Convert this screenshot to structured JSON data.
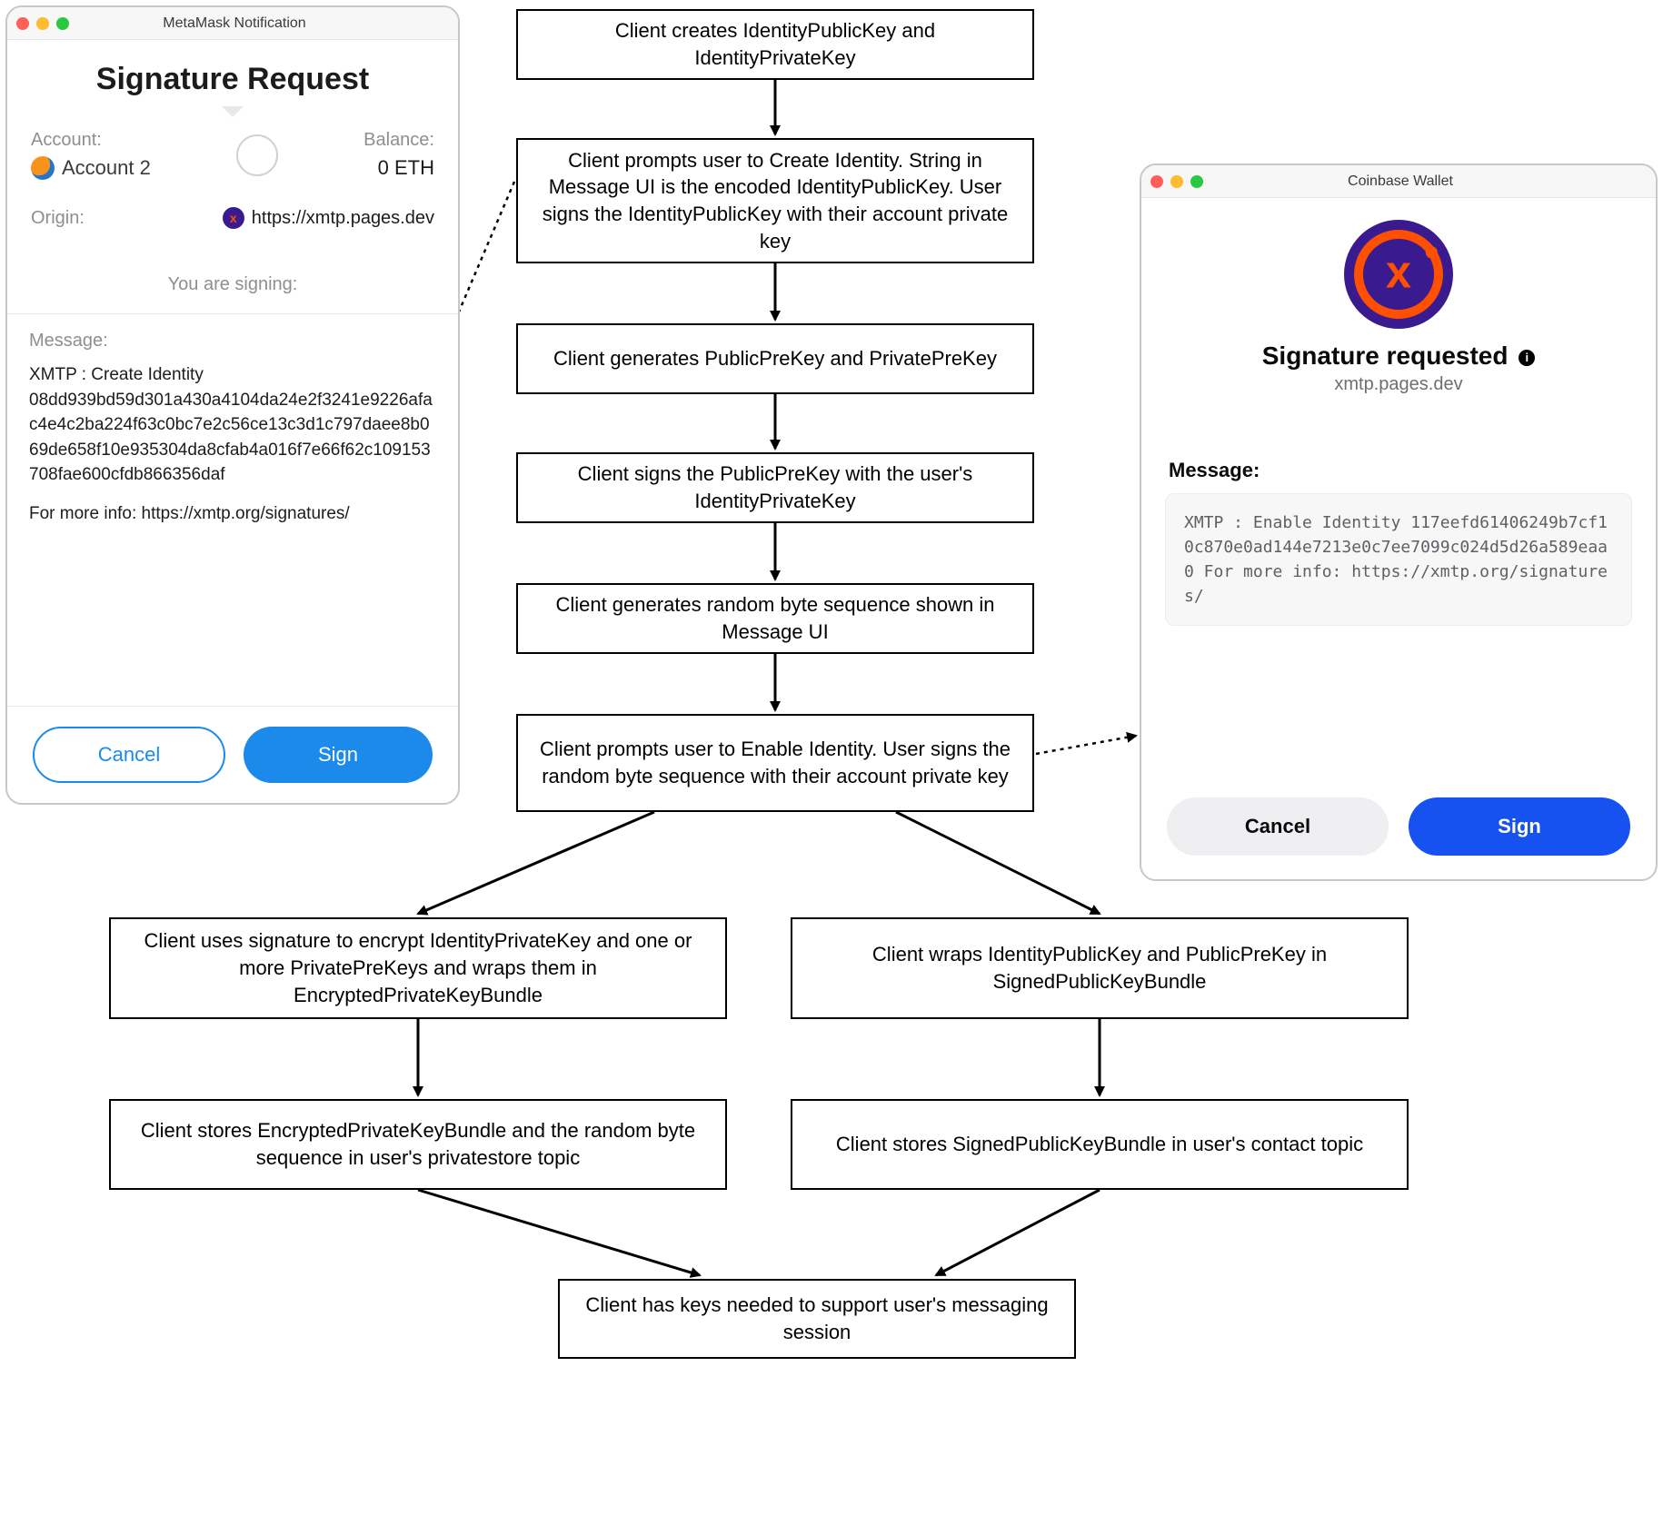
{
  "flow": {
    "step1": "Client creates IdentityPublicKey and IdentityPrivateKey",
    "step2": "Client prompts user to Create Identity. String in Message UI is the encoded IdentityPublicKey. User signs the IdentityPublicKey with their account private key",
    "step3": "Client generates PublicPreKey and PrivatePreKey",
    "step4": "Client signs the PublicPreKey with the user's IdentityPrivateKey",
    "step5": "Client generates random byte sequence shown in Message UI",
    "step6": "Client prompts user to Enable Identity. User signs the random byte sequence with their account private key",
    "step7L": "Client uses signature to encrypt IdentityPrivateKey and one or more PrivatePreKeys and wraps them in EncryptedPrivateKeyBundle",
    "step7R": "Client wraps IdentityPublicKey and PublicPreKey in SignedPublicKeyBundle",
    "step8L": "Client stores EncryptedPrivateKeyBundle and the random byte sequence in user's privatestore topic",
    "step8R": "Client stores SignedPublicKeyBundle in user's contact topic",
    "step9": "Client has keys needed to support user's messaging session"
  },
  "metamask": {
    "window_title": "MetaMask Notification",
    "heading": "Signature Request",
    "account_label": "Account:",
    "account_name": "Account 2",
    "balance_label": "Balance:",
    "balance_value": "0 ETH",
    "origin_label": "Origin:",
    "origin_value": "https://xmtp.pages.dev",
    "signing_text": "You are signing:",
    "message_label": "Message:",
    "message_title": "XMTP : Create Identity",
    "message_body": "08dd939bd59d301a430a4104da24e2f3241e9226afac4e4c2ba224f63c0bc7e2c56ce13c3d1c797daee8b069de658f10e935304da8cfab4a016f7e66f62c109153708fae600cfdb866356daf",
    "message_info": "For more info: https://xmtp.org/signatures/",
    "cancel": "Cancel",
    "sign": "Sign"
  },
  "coinbase": {
    "window_title": "Coinbase Wallet",
    "heading": "Signature requested",
    "domain": "xmtp.pages.dev",
    "message_label": "Message:",
    "message_body": "XMTP : Enable Identity 117eefd61406249b7cf10c870e0ad144e7213e0c7ee7099c024d5d26a589eaa0 For more info: https://xmtp.org/signatures/",
    "cancel": "Cancel",
    "sign": "Sign"
  }
}
